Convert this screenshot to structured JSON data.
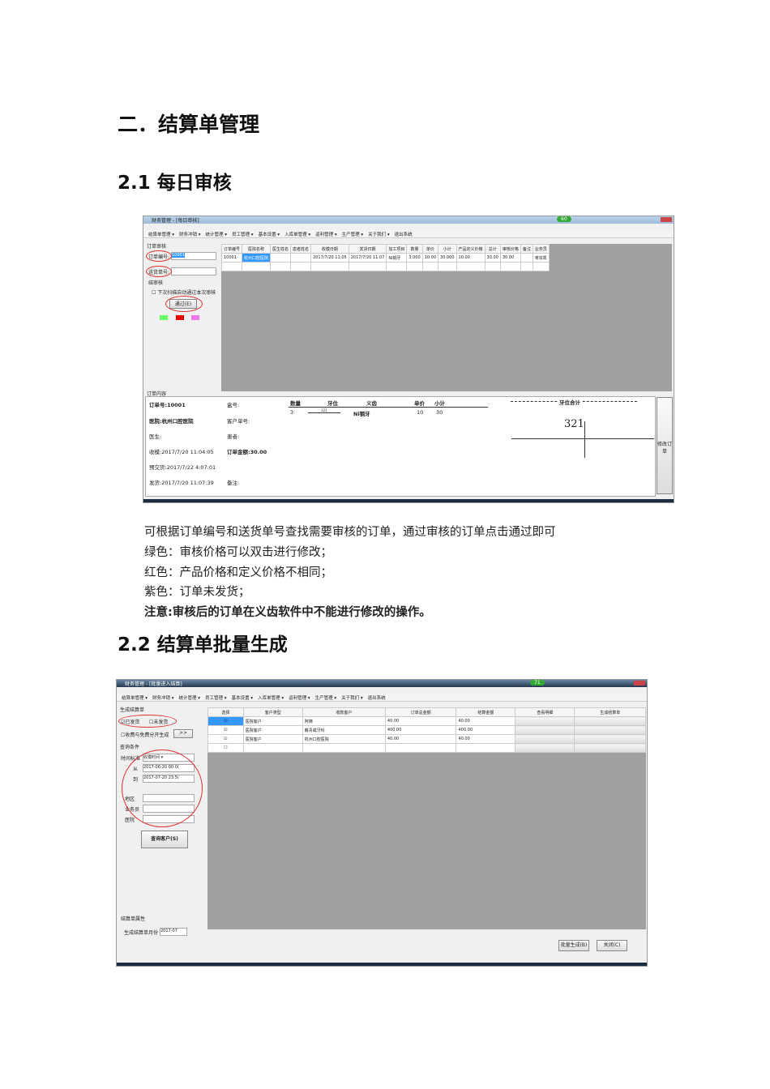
{
  "heading": "二．结算单管理",
  "section1": {
    "title": "2.1 每日审核",
    "screenshot": {
      "window_title": "财务管理 - [每日审核]",
      "badge": "60",
      "menu": [
        "结算单管理 ▾",
        "财务冲销 ▾",
        "统计管理 ▾",
        "员工管理 ▾",
        "基本设置 ▾",
        "入库单管理 ▾",
        "返利管理 ▾",
        "生产管理 ▾",
        "关于我们 ▾",
        "退出系统"
      ],
      "left": {
        "group": "订单审核",
        "order_no_label": "订单编号:",
        "order_no_value": "10001",
        "delivery_no_label": "送货单号:",
        "review_group": "结审核",
        "auto_checkbox": "下次扫描自动通过本次审核",
        "pass_button": "通过(E)"
      },
      "colors": {
        "green": "#66ff66",
        "red": "#ee0000",
        "purple": "#ee77ee"
      },
      "columns": [
        "订单编号",
        "医院名称",
        "医生姓名",
        "患者姓名",
        "收模日期",
        "发货日期",
        "加工项目",
        "数量",
        "单价",
        "小计",
        "产品定义价格",
        "总计",
        "审核价格",
        "备注",
        "业务员"
      ],
      "rows": [
        [
          "10001",
          "杭州口腔医院",
          "",
          "",
          "2017/7/20 11:05",
          "2017/7/20 11:07",
          "Ni钢牙",
          "3.000",
          "10.00",
          "30.000",
          "10.00",
          "30.00",
          "30.00",
          "",
          "蒋宗凯"
        ]
      ],
      "detail": {
        "group": "订单内容",
        "order": "订单号:10001",
        "box": "盒号:",
        "hospital": "医院:杭州口腔医院",
        "customer_no": "客户单号:",
        "doctor": "医生:",
        "patient": "患者:",
        "received": "收模:2017/7/20 11:04:05",
        "amount": "订单金额:30.00",
        "expected": "预交货:2017/7/22 4:07:01",
        "shipped": "发货:2017/7/20 11:07:39",
        "remark": "备注:",
        "item_headers": [
          "数量",
          "牙位",
          "义齿",
          "单价",
          "小计"
        ],
        "item": [
          "3",
          "321",
          "Ni钢牙",
          "10",
          "30"
        ],
        "tooth_total_label": "牙位合计",
        "tooth_total_value": "321",
        "modify_button": "修改订单"
      }
    }
  },
  "paragraphs": [
    "可根据订单编号和送货单号查找需要审核的订单，通过审核的订单点击通过即可",
    "绿色：审核价格可以双击进行修改；",
    "红色：产品价格和定义价格不相同；",
    "紫色：订单未发货；",
    "注意:审核后的订单在义齿软件中不能进行修改的操作。"
  ],
  "section2": {
    "title": "2.2 结算单批量生成",
    "screenshot": {
      "window_title": "财务管理 - [批量进入结算]",
      "badge": "71",
      "menu": [
        "结算单管理 ▾",
        "财务冲销 ▾",
        "统计管理 ▾",
        "员工管理 ▾",
        "基本设置 ▾",
        "入库单管理 ▾",
        "返利管理 ▾",
        "生产管理 ▾",
        "关于我们 ▾",
        "退出系统"
      ],
      "left": {
        "group": "生成结算单",
        "shipped": "已发货",
        "unshipped": "未发货",
        "split": "收费与免费分开生成",
        "arrow_button": ">>",
        "query_group": "查询条件",
        "time_std_label": "时间标准",
        "time_std_value": "收模时间",
        "from_label": "从",
        "from_value": "2017-06-20 00:0(",
        "to_label": "到",
        "to_value": "2017-07-20 23:5(",
        "region_label": "地区",
        "sales_label": "业务员",
        "hospital_label": "医院",
        "query_button": "查询客户(S)",
        "attr_group": "结算单属性",
        "month_label": "生成结算单月份",
        "month_value": "2017-07"
      },
      "columns": [
        "选择",
        "客户类型",
        "收款客户",
        "订单总金额",
        "结算金额",
        "查看明细",
        "生成结算单"
      ],
      "rows": [
        [
          "医院客户",
          "阿姨",
          "40.00",
          "40.00"
        ],
        [
          "医院客户",
          "戴青或牙科",
          "400.00",
          "400.00"
        ],
        [
          "医院客户",
          "杭州口腔医院",
          "40.00",
          "40.00"
        ],
        [
          "",
          "",
          "",
          ""
        ]
      ],
      "batch_button": "批量生成(B)",
      "close_button": "关闭(C)"
    }
  }
}
